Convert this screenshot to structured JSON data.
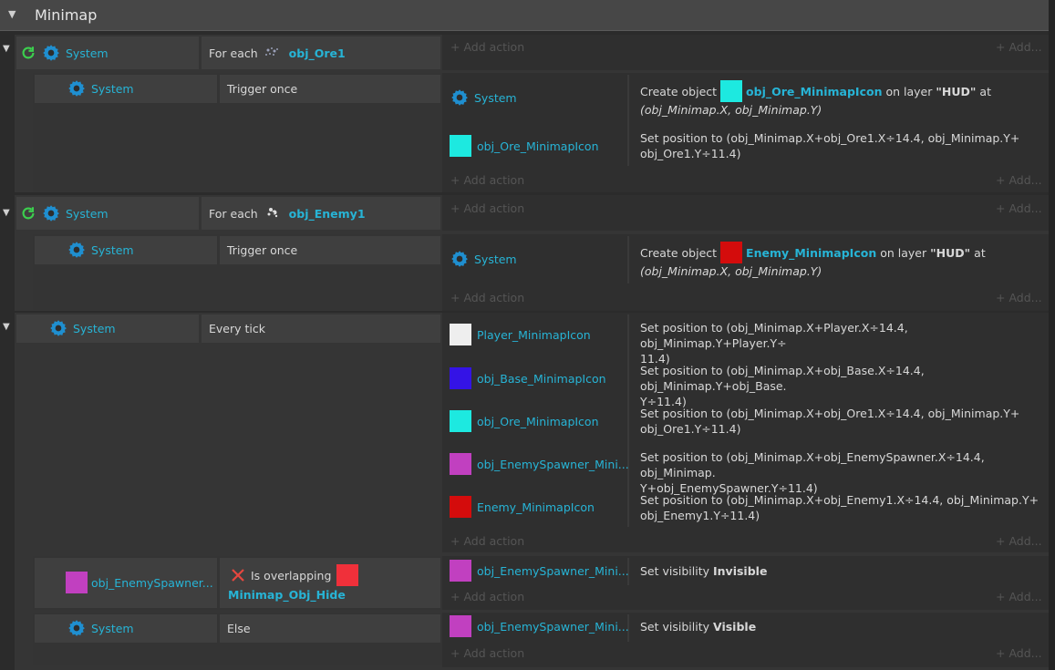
{
  "group": {
    "title": "Minimap",
    "collapse_icon": "triangle-down-icon"
  },
  "common": {
    "add_action": "Add action",
    "add_more": "Add...",
    "system": "System",
    "trigger_once": "Trigger once",
    "plus": "+"
  },
  "colors": {
    "cyan": "#1de9e0",
    "red": "#d40c0c",
    "white": "#eeeeee",
    "blue": "#3413e6",
    "magenta": "#c140c0",
    "hide_red": "#f0303a",
    "accent": "#27b4d6"
  },
  "events": {
    "ore": {
      "condition_prefix": "For each",
      "object": "obj_Ore1",
      "sub": {
        "condition": "Trigger once",
        "actions": [
          {
            "object": "System",
            "text_prefix": "Create object",
            "target": "obj_Ore_MinimapIcon",
            "text_mid": "on layer",
            "layer": "\"HUD\"",
            "text_suffix": "at",
            "line2": "(obj_Minimap.X, obj_Minimap.Y)"
          },
          {
            "object": "obj_Ore_MinimapIcon",
            "line1": "Set position to (obj_Minimap.X+obj_Ore1.X÷14.4, obj_Minimap.Y+",
            "line2": "obj_Ore1.Y÷11.4)"
          }
        ]
      }
    },
    "enemy": {
      "condition_prefix": "For each",
      "object": "obj_Enemy1",
      "sub": {
        "condition": "Trigger once",
        "actions": [
          {
            "object": "System",
            "text_prefix": "Create object",
            "target": "Enemy_MinimapIcon",
            "text_mid": "on layer",
            "layer": "\"HUD\"",
            "text_suffix": "at",
            "line2": "(obj_Minimap.X, obj_Minimap.Y)"
          }
        ]
      }
    },
    "tick": {
      "condition": "Every tick",
      "actions": [
        {
          "object": "Player_MinimapIcon",
          "line1": "Set position to (obj_Minimap.X+Player.X÷14.4, obj_Minimap.Y+Player.Y÷",
          "line2": "11.4)"
        },
        {
          "object": "obj_Base_MinimapIcon",
          "line1": "Set position to (obj_Minimap.X+obj_Base.X÷14.4, obj_Minimap.Y+obj_Base.",
          "line2": "Y÷11.4)"
        },
        {
          "object": "obj_Ore_MinimapIcon",
          "line1": "Set position to (obj_Minimap.X+obj_Ore1.X÷14.4, obj_Minimap.Y+",
          "line2": "obj_Ore1.Y÷11.4)"
        },
        {
          "object": "obj_EnemySpawner_Mini...",
          "line1": "Set position to (obj_Minimap.X+obj_EnemySpawner.X÷14.4, obj_Minimap.",
          "line2": "Y+obj_EnemySpawner.Y÷11.4)"
        },
        {
          "object": "Enemy_MinimapIcon",
          "line1": "Set position to (obj_Minimap.X+obj_Enemy1.X÷14.4, obj_Minimap.Y+",
          "line2": "obj_Enemy1.Y÷11.4)"
        }
      ],
      "sub_overlap": {
        "object": "obj_EnemySpawner...",
        "condition": "Is overlapping",
        "target": "Minimap_Obj_Hide",
        "action_object": "obj_EnemySpawner_Mini...",
        "action_prefix": "Set visibility",
        "action_value": "Invisible"
      },
      "sub_else": {
        "condition": "Else",
        "action_object": "obj_EnemySpawner_Mini...",
        "action_prefix": "Set visibility",
        "action_value": "Visible"
      }
    }
  }
}
